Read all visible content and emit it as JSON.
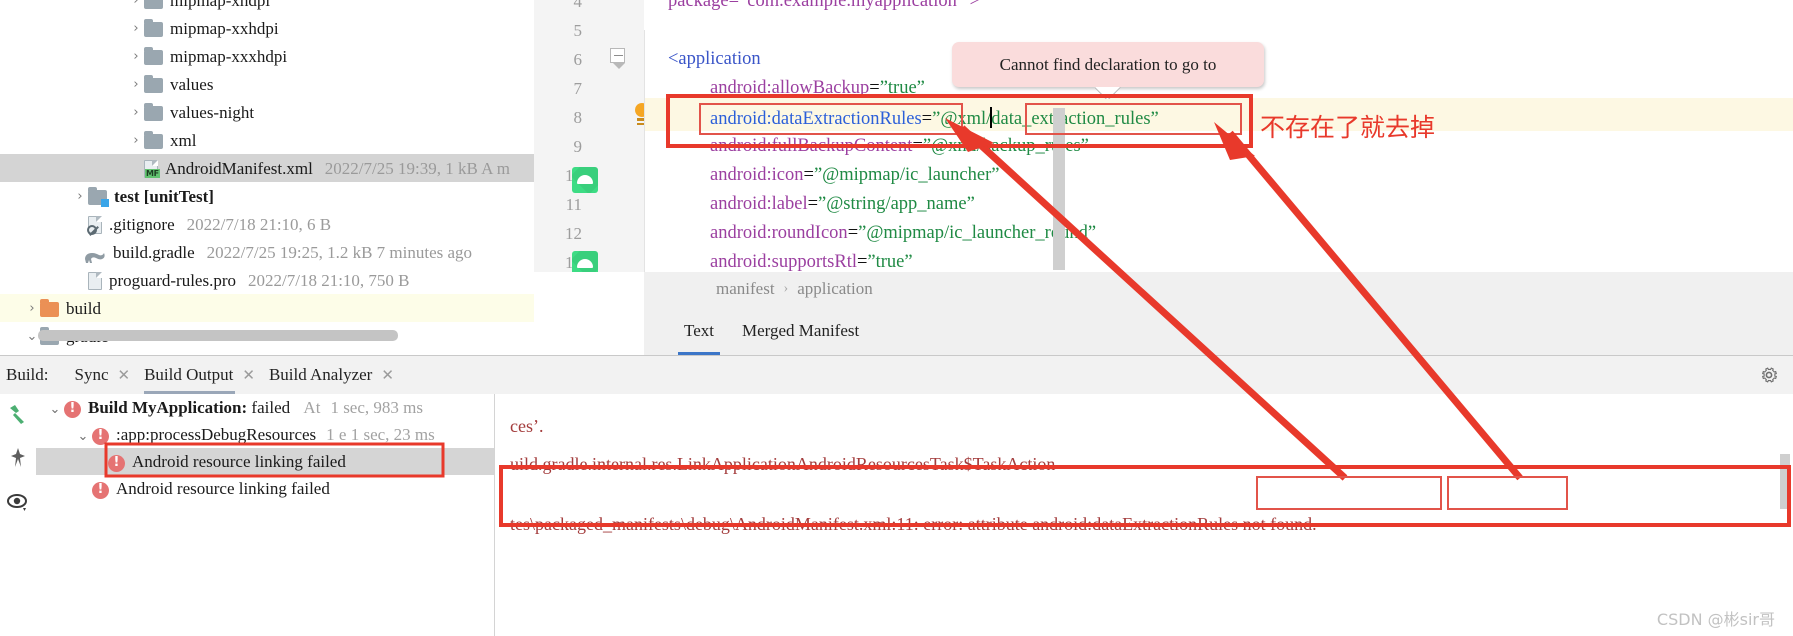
{
  "project_tree": {
    "rows": [
      {
        "indent": 128,
        "chevron": "›",
        "icon": "folder",
        "name": "mipmap-xhdpi",
        "meta": "",
        "clipped": true
      },
      {
        "indent": 128,
        "chevron": "›",
        "icon": "folder",
        "name": "mipmap-xxhdpi",
        "meta": ""
      },
      {
        "indent": 128,
        "chevron": "›",
        "icon": "folder",
        "name": "mipmap-xxxhdpi",
        "meta": ""
      },
      {
        "indent": 128,
        "chevron": "›",
        "icon": "folder",
        "name": "values",
        "meta": ""
      },
      {
        "indent": 128,
        "chevron": "›",
        "icon": "folder",
        "name": "values-night",
        "meta": ""
      },
      {
        "indent": 128,
        "chevron": "›",
        "icon": "folder",
        "name": "xml",
        "meta": ""
      },
      {
        "indent": 128,
        "chevron": "",
        "icon": "manifest-file",
        "name": "AndroidManifest.xml",
        "meta": "2022/7/25 19:39,  1 kB  A m",
        "selected": true
      },
      {
        "indent": 72,
        "chevron": "›",
        "icon": "folder-test",
        "name": "test [unitTest]",
        "bold": true,
        "meta": ""
      },
      {
        "indent": 88,
        "chevron": "",
        "icon": "gitignore-file",
        "name": ".gitignore",
        "meta": "2022/7/18 21:10,  6 B"
      },
      {
        "indent": 88,
        "chevron": "",
        "icon": "gradle-file",
        "name": "build.gradle",
        "meta": "2022/7/25 19:25,  1.2 kB 7 minutes ago"
      },
      {
        "indent": 88,
        "chevron": "",
        "icon": "pro-file",
        "name": "proguard-rules.pro",
        "meta": "2022/7/18 21:10,  750 B"
      },
      {
        "indent": 24,
        "chevron": "›",
        "icon": "folder-orange",
        "name": "build",
        "meta": "",
        "build_row": true
      },
      {
        "indent": 24,
        "chevron": "⌄",
        "icon": "folder",
        "name": "gradle",
        "meta": ""
      }
    ]
  },
  "editor": {
    "line_numbers": [
      "4",
      "5",
      "6",
      "7",
      "8",
      "9",
      "10",
      "11",
      "12",
      "13"
    ],
    "code_lines": [
      {
        "n": "4",
        "segments": [
          {
            "t": "package",
            "c": "attr"
          },
          {
            "t": "=",
            "c": "eq"
          },
          {
            "t": "”com.example.myapplication”",
            "c": "str"
          },
          {
            "t": " >",
            "c": "tag"
          }
        ]
      },
      {
        "n": "5",
        "segments": []
      },
      {
        "n": "6",
        "segments": [
          {
            "t": "<application",
            "c": "tag"
          }
        ]
      },
      {
        "n": "7",
        "segments": [
          {
            "t": "android:allowBackup",
            "c": "attr"
          },
          {
            "t": "=",
            "c": "eq"
          },
          {
            "t": "”true”",
            "c": "str"
          }
        ]
      },
      {
        "n": "8",
        "segments": [
          {
            "t": "android:dataExtractionRules",
            "c": "attr-b"
          },
          {
            "t": "=",
            "c": "eq"
          },
          {
            "t": "”@xml/data_extraction_rules”",
            "c": "str"
          }
        ]
      },
      {
        "n": "9",
        "segments": [
          {
            "t": "android:fullBackupContent",
            "c": "attr"
          },
          {
            "t": "=",
            "c": "eq"
          },
          {
            "t": "”@xml/backup_rules”",
            "c": "str"
          }
        ]
      },
      {
        "n": "10",
        "segments": [
          {
            "t": "android:icon",
            "c": "attr"
          },
          {
            "t": "=",
            "c": "eq"
          },
          {
            "t": "”@mipmap/ic_launcher”",
            "c": "str"
          }
        ]
      },
      {
        "n": "11",
        "segments": [
          {
            "t": "android:label",
            "c": "attr"
          },
          {
            "t": "=",
            "c": "eq"
          },
          {
            "t": "”@string/app_name”",
            "c": "str"
          }
        ]
      },
      {
        "n": "12",
        "segments": [
          {
            "t": "android:roundIcon",
            "c": "attr"
          },
          {
            "t": "=",
            "c": "eq"
          },
          {
            "t": "”@mipmap/ic_launcher_round”",
            "c": "str"
          }
        ]
      },
      {
        "n": "13",
        "segments": [
          {
            "t": "android:supportsRtl",
            "c": "attr"
          },
          {
            "t": "=",
            "c": "eq"
          },
          {
            "t": "”true”",
            "c": "str"
          }
        ]
      }
    ],
    "line4_text": "package=”com.example.myapplication” >",
    "line6_text": "<application",
    "line7_attr": "android:allowBackup",
    "line7_val": "”true”",
    "line8_attr": "android:dataExtractionRules",
    "line8_val_pre": "”@xml/",
    "line8_val_post": "data_extraction_rules”",
    "line9_attr": "android:fullBackupContent",
    "line9_val": "”@xml/backup_rules”",
    "line10_attr": "android:icon",
    "line10_val": "”@mipmap/ic_launcher”",
    "line11_attr": "android:label",
    "line11_val": "”@string/app_name”",
    "line12_attr": "android:roundIcon",
    "line12_val": "”@mipmap/ic_launcher_round”",
    "line13_attr": "android:supportsRtl",
    "line13_val": "”true”",
    "equals": "=",
    "tooltip": "Cannot find declaration to go to",
    "breadcrumb": [
      "manifest",
      "application"
    ],
    "breadcrumb_sep": "›",
    "tabs": [
      {
        "label": "Text",
        "active": true
      },
      {
        "label": "Merged Manifest",
        "active": false
      }
    ]
  },
  "build_panel": {
    "title": "Build:",
    "tabs": [
      {
        "label": "Sync",
        "closable": true,
        "active": false
      },
      {
        "label": "Build Output",
        "closable": true,
        "active": true
      },
      {
        "label": "Build Analyzer",
        "closable": true,
        "active": false
      }
    ],
    "close_glyph": "✕",
    "gear_icon": "gear-icon",
    "side_icons": [
      "build-hammer-icon",
      "pin-icon",
      "eye-icon"
    ],
    "tree": [
      {
        "indent": 10,
        "chevron": "⌄",
        "bold_prefix": "Build MyApplication:",
        "text": " failed",
        "suffix": " At",
        "time": "1 sec, 983 ms"
      },
      {
        "indent": 38,
        "chevron": "⌄",
        "bold_prefix": "",
        "text": ":app:processDebugResources",
        "suffix": "",
        "time": "1 e 1 sec, 23 ms"
      },
      {
        "indent": 66,
        "chevron": "",
        "bold_prefix": "",
        "text": "Android resource linking failed",
        "suffix": "",
        "time": "",
        "selected": true,
        "boxed": true
      },
      {
        "indent": 48,
        "chevron": "",
        "bold_prefix": "",
        "text": "Android resource linking failed",
        "suffix": "",
        "time": ""
      }
    ],
    "console_lines": [
      "ces’.",
      "uild.gradle.internal.res.LinkApplicationAndroidResourcesTask$TaskAction",
      "tes\\packaged_manifests\\debug\\AndroidManifest.xml:11: error: attribute android:dataExtractionRules not found."
    ],
    "console_line3_pre": "tes\\packaged_manifests\\debug\\AndroidManifest.xml:11: error: attribute android:",
    "console_line3_attr": "dataExtractionRules",
    "console_line3_tail": "not found."
  },
  "annotations": {
    "chinese_note": "不存在了就去掉",
    "accent_red": "#e8392b"
  },
  "watermark": "CSDN @彬sir哥"
}
